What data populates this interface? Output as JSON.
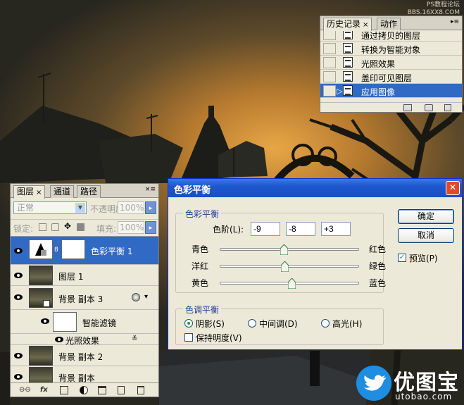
{
  "watermark": "PS教程论坛\nBBS.16XX8.COM",
  "history": {
    "tabs": [
      "历史记录",
      "动作"
    ],
    "close": "×",
    "items": [
      "通过拷贝的图层",
      "转换为智能对象",
      "光照效果",
      "盖印可见图层",
      "应用图像"
    ],
    "selected_index": 4
  },
  "layers": {
    "tabs": [
      "图层",
      "通道",
      "路径"
    ],
    "close": "×",
    "blend_mode": "正常",
    "opacity_label": "不透明度:",
    "opacity_value": "100%",
    "lock_label": "锁定:",
    "fill_label": "填充:",
    "fill_value": "100%",
    "items": [
      {
        "name": "色彩平衡 1",
        "type": "adjustment",
        "selected": true
      },
      {
        "name": "图层 1",
        "type": "pixel"
      },
      {
        "name": "背景 副本 3",
        "type": "smart"
      },
      {
        "name": "智能滤镜",
        "type": "smart-filter-mask"
      },
      {
        "name": "光照效果",
        "type": "filter"
      },
      {
        "name": "背景 副本 2",
        "type": "pixel"
      },
      {
        "name": "背景 副本",
        "type": "pixel"
      }
    ],
    "bottom_icons": [
      "link-icon",
      "fx-icon",
      "mask-icon",
      "adjustment-icon",
      "folder-icon",
      "new-layer-icon",
      "trash-icon"
    ],
    "fx_label": "fx"
  },
  "dialog": {
    "title": "色彩平衡",
    "close": "✕",
    "balance_group": "色彩平衡",
    "levels_label": "色阶(L):",
    "levels": [
      "-9",
      "-8",
      "+3"
    ],
    "sliders": [
      {
        "left": "青色",
        "right": "红色",
        "value": -9
      },
      {
        "left": "洋红",
        "right": "绿色",
        "value": -8
      },
      {
        "left": "黄色",
        "right": "蓝色",
        "value": 3
      }
    ],
    "tone_group": "色调平衡",
    "tones": [
      "阴影(S)",
      "中间调(D)",
      "高光(H)"
    ],
    "selected_tone": 0,
    "preserve_label": "保持明度(V)",
    "preserve_checked": false,
    "ok_label": "确定",
    "cancel_label": "取消",
    "preview_label": "预览(P)",
    "preview_checked": true
  },
  "logo": {
    "name": "优图宝",
    "url": "utobao.com"
  },
  "colors": {
    "selection": "#316ac5",
    "titlebar": "#1e56cf",
    "logo_blue": "#1f8de0"
  }
}
